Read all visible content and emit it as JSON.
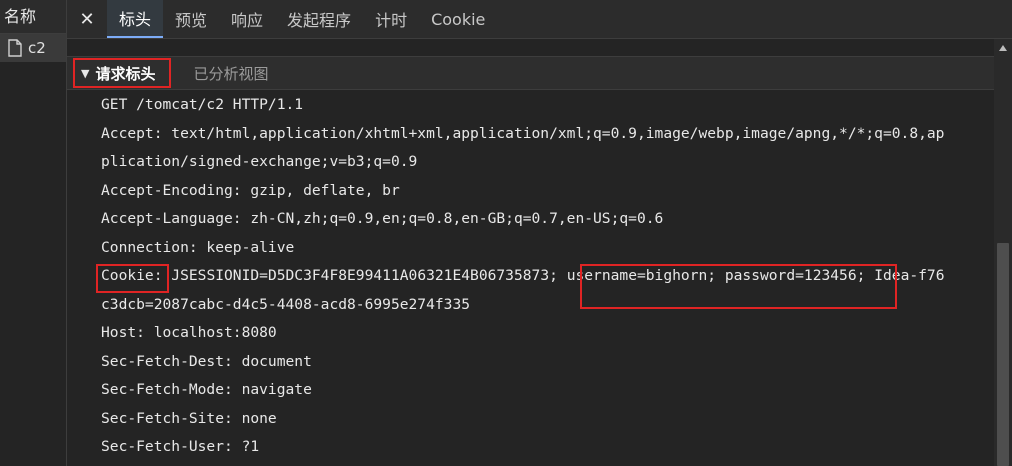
{
  "sidebar": {
    "header": "名称",
    "items": [
      {
        "name": "c2",
        "icon": "document-icon"
      }
    ]
  },
  "tabs": {
    "close_icon": "close-icon",
    "items": [
      {
        "label": "标头",
        "active": true
      },
      {
        "label": "预览",
        "active": false
      },
      {
        "label": "响应",
        "active": false
      },
      {
        "label": "发起程序",
        "active": false
      },
      {
        "label": "计时",
        "active": false
      },
      {
        "label": "Cookie",
        "active": false
      }
    ]
  },
  "section": {
    "title": "请求标头",
    "toggle_icon": "triangle-down-icon",
    "view_parsed": "已分析视图"
  },
  "headers": {
    "request_line": "GET /tomcat/c2 HTTP/1.1",
    "accept_1": "Accept: text/html,application/xhtml+xml,application/xml;q=0.9,image/webp,image/apng,*/*;q=0.8,ap",
    "accept_2": "plication/signed-exchange;v=b3;q=0.9",
    "accept_encoding": "Accept-Encoding: gzip, deflate, br",
    "accept_language": "Accept-Language: zh-CN,zh;q=0.9,en;q=0.8,en-GB;q=0.7,en-US;q=0.6",
    "connection": "Connection: keep-alive",
    "cookie_key": "Cookie:",
    "cookie_val_1": " JSESSIONID=D5DC3F4F8E99411A06321E4B06735873; ",
    "cookie_user_pass": "username=bighorn; password=123456;",
    "cookie_val_2": " Idea-f76",
    "cookie_cont": "c3dcb=2087cabc-d4c5-4408-acd8-6995e274f335",
    "host": "Host: localhost:8080",
    "sec_fetch_dest": "Sec-Fetch-Dest: document",
    "sec_fetch_mode": "Sec-Fetch-Mode: navigate",
    "sec_fetch_site": "Sec-Fetch-Site: none",
    "sec_fetch_user": "Sec-Fetch-User: ?1"
  },
  "colors": {
    "background": "#242424",
    "highlight_border": "#e02424",
    "active_tab_underline": "#7cacf8"
  }
}
